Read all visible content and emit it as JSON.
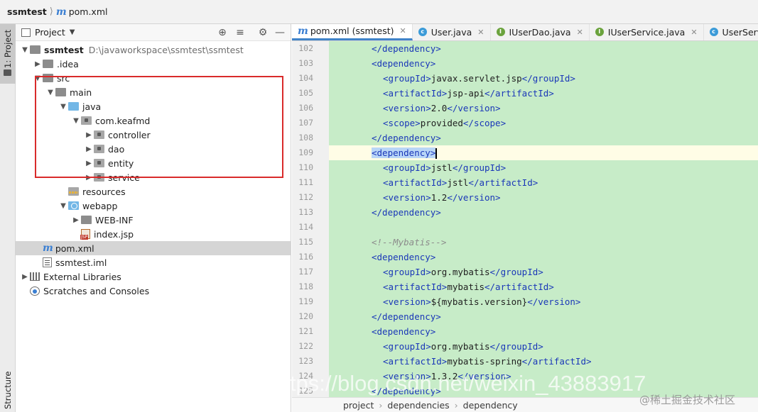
{
  "breadcrumb": {
    "project": "ssmtest",
    "file": "pom.xml"
  },
  "tool_stripe": {
    "project_label": "1: Project",
    "structure_label": "Structure"
  },
  "project_panel": {
    "title": "Project",
    "tree": [
      {
        "label": "ssmtest",
        "path": "D:\\javaworkspace\\ssmtest\\ssmtest"
      },
      {
        "label": ".idea"
      },
      {
        "label": "src"
      },
      {
        "label": "main"
      },
      {
        "label": "java"
      },
      {
        "label": "com.keafmd"
      },
      {
        "label": "controller"
      },
      {
        "label": "dao"
      },
      {
        "label": "entity"
      },
      {
        "label": "service"
      },
      {
        "label": "resources"
      },
      {
        "label": "webapp"
      },
      {
        "label": "WEB-INF"
      },
      {
        "label": "index.jsp"
      },
      {
        "label": "pom.xml"
      },
      {
        "label": "ssmtest.iml"
      },
      {
        "label": "External Libraries"
      },
      {
        "label": "Scratches and Consoles"
      }
    ]
  },
  "tabs": [
    {
      "label": "pom.xml (ssmtest)",
      "icon": "maven-icon",
      "active": true
    },
    {
      "label": "User.java",
      "icon": "class-icon"
    },
    {
      "label": "IUserDao.java",
      "icon": "interface-icon"
    },
    {
      "label": "IUserService.java",
      "icon": "interface-icon"
    },
    {
      "label": "UserServiceImp",
      "icon": "class-icon"
    }
  ],
  "code": [
    {
      "ln": "102",
      "open": "",
      "text": "",
      "close": "</dependency>",
      "indent": 1
    },
    {
      "ln": "103",
      "open": "<dependency>",
      "text": "",
      "close": "",
      "indent": 1
    },
    {
      "ln": "104",
      "open": "<groupId>",
      "text": "javax.servlet.jsp",
      "close": "</groupId>",
      "indent": 2
    },
    {
      "ln": "105",
      "open": "<artifactId>",
      "text": "jsp-api",
      "close": "</artifactId>",
      "indent": 2
    },
    {
      "ln": "106",
      "open": "<version>",
      "text": "2.0",
      "close": "</version>",
      "indent": 2
    },
    {
      "ln": "107",
      "open": "<scope>",
      "text": "provided",
      "close": "</scope>",
      "indent": 2
    },
    {
      "ln": "108",
      "open": "",
      "text": "",
      "close": "</dependency>",
      "indent": 1
    },
    {
      "ln": "109",
      "open": "<dependency>",
      "text": "",
      "close": "",
      "indent": 1
    },
    {
      "ln": "110",
      "open": "<groupId>",
      "text": "jstl",
      "close": "</groupId>",
      "indent": 2
    },
    {
      "ln": "111",
      "open": "<artifactId>",
      "text": "jstl",
      "close": "</artifactId>",
      "indent": 2
    },
    {
      "ln": "112",
      "open": "<version>",
      "text": "1.2",
      "close": "</version>",
      "indent": 2
    },
    {
      "ln": "113",
      "open": "",
      "text": "",
      "close": "</dependency>",
      "indent": 1
    },
    {
      "ln": "114",
      "open": "",
      "text": "",
      "close": "",
      "indent": 0
    },
    {
      "ln": "115",
      "comment": "<!--Mybatis-->",
      "indent": 1
    },
    {
      "ln": "116",
      "open": "<dependency>",
      "text": "",
      "close": "",
      "indent": 1
    },
    {
      "ln": "117",
      "open": "<groupId>",
      "text": "org.mybatis",
      "close": "</groupId>",
      "indent": 2
    },
    {
      "ln": "118",
      "open": "<artifactId>",
      "text": "mybatis",
      "close": "</artifactId>",
      "indent": 2
    },
    {
      "ln": "119",
      "open": "<version>",
      "text": "${mybatis.version}",
      "close": "</version>",
      "indent": 2
    },
    {
      "ln": "120",
      "open": "",
      "text": "",
      "close": "</dependency>",
      "indent": 1
    },
    {
      "ln": "121",
      "open": "<dependency>",
      "text": "",
      "close": "",
      "indent": 1
    },
    {
      "ln": "122",
      "open": "<groupId>",
      "text": "org.mybatis",
      "close": "</groupId>",
      "indent": 2
    },
    {
      "ln": "123",
      "open": "<artifactId>",
      "text": "mybatis-spring",
      "close": "</artifactId>",
      "indent": 2
    },
    {
      "ln": "124",
      "open": "<version>",
      "text": "1.3.2",
      "close": "</version>",
      "indent": 2
    },
    {
      "ln": "125",
      "open": "",
      "text": "",
      "close": "</dependency>",
      "indent": 1
    }
  ],
  "editor_breadcrumb": [
    "project",
    "dependencies",
    "dependency"
  ],
  "watermark": "https://blog.csdn.net/weixin_43883917",
  "watermark_cn": "@稀土掘金技术社区",
  "colors": {
    "code_background": "#c7ecc8",
    "tag": "#1a37b8",
    "highlight_box": "#d92b2b",
    "active_tab_underline": "#4083c9"
  }
}
